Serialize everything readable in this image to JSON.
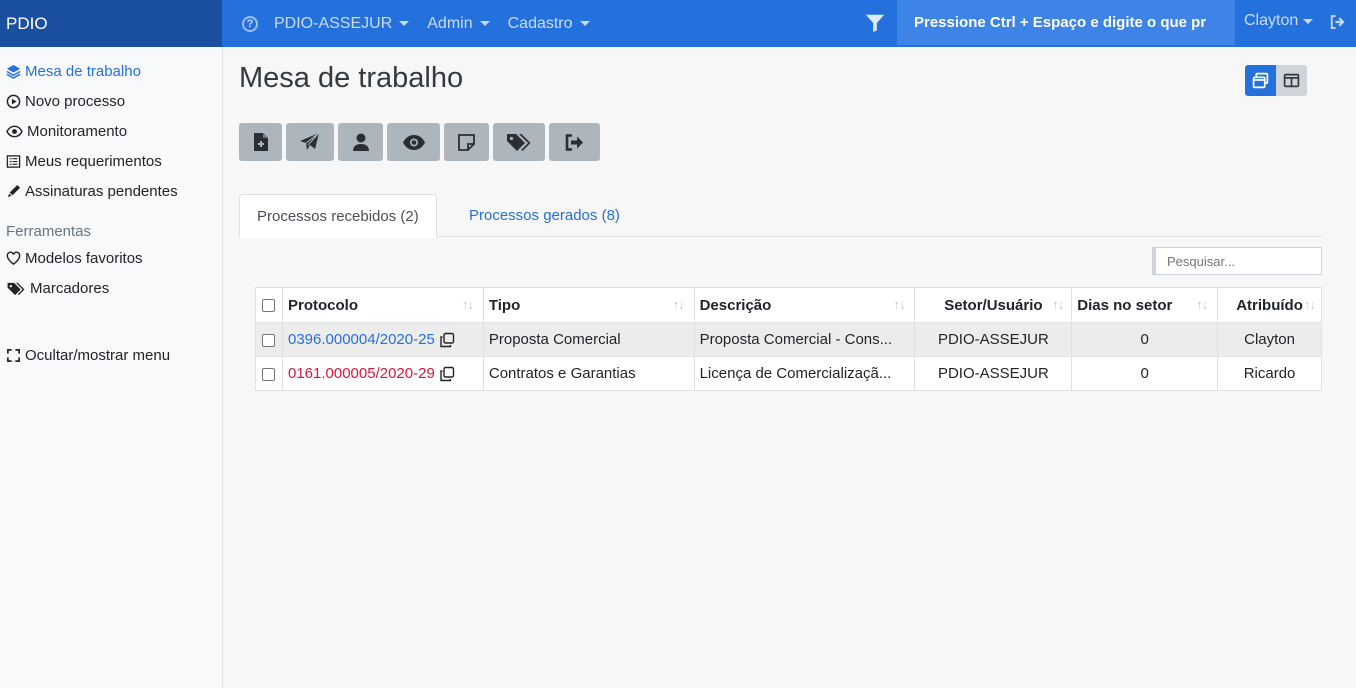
{
  "navbar": {
    "brand": "PDIO",
    "menus": [
      "PDIO-ASSEJUR",
      "Admin",
      "Cadastro"
    ],
    "search_text": "Pressione Ctrl + Espaço e digite o que pr",
    "user": "Clayton"
  },
  "sidebar": {
    "items": [
      {
        "label": "Mesa de trabalho",
        "icon": "layers-icon"
      },
      {
        "label": "Novo processo",
        "icon": "play-circle-icon"
      },
      {
        "label": "Monitoramento",
        "icon": "eye-icon"
      },
      {
        "label": "Meus requerimentos",
        "icon": "list-box-icon"
      },
      {
        "label": "Assinaturas pendentes",
        "icon": "pen-icon"
      }
    ],
    "tools_heading": "Ferramentas",
    "tools": [
      {
        "label": "Modelos favoritos",
        "icon": "heart-icon"
      },
      {
        "label": "Marcadores",
        "icon": "tags-icon"
      }
    ],
    "toggle_menu": "Ocultar/mostrar menu"
  },
  "main": {
    "title": "Mesa de trabalho",
    "toolbar": [
      "file-plus-icon",
      "paper-plane-icon",
      "user-icon",
      "eye-icon",
      "sticky-note-icon",
      "tags-icon",
      "sign-out-icon"
    ],
    "tabs": [
      {
        "label": "Processos recebidos (2)",
        "active": true
      },
      {
        "label": "Processos gerados (8)",
        "active": false
      }
    ],
    "search_placeholder": "Pesquisar...",
    "table": {
      "headers": [
        "Protocolo",
        "Tipo",
        "Descrição",
        "Setor/Usuário",
        "Dias no setor",
        "Atribuído"
      ],
      "rows": [
        {
          "protocolo": "0396.000004/2020-25",
          "tipo": "Proposta Comercial",
          "descricao": "Proposta Comercial - Cons...",
          "setor": "PDIO-ASSEJUR",
          "dias": "0",
          "atribuido": "Clayton",
          "color": "#2470dc"
        },
        {
          "protocolo": "0161.000005/2020-29",
          "tipo": "Contratos e Garantias",
          "descricao": "Licença de Comercializaçã...",
          "setor": "PDIO-ASSEJUR",
          "dias": "0",
          "atribuido": "Ricardo",
          "color": "#dc143c"
        }
      ]
    }
  }
}
